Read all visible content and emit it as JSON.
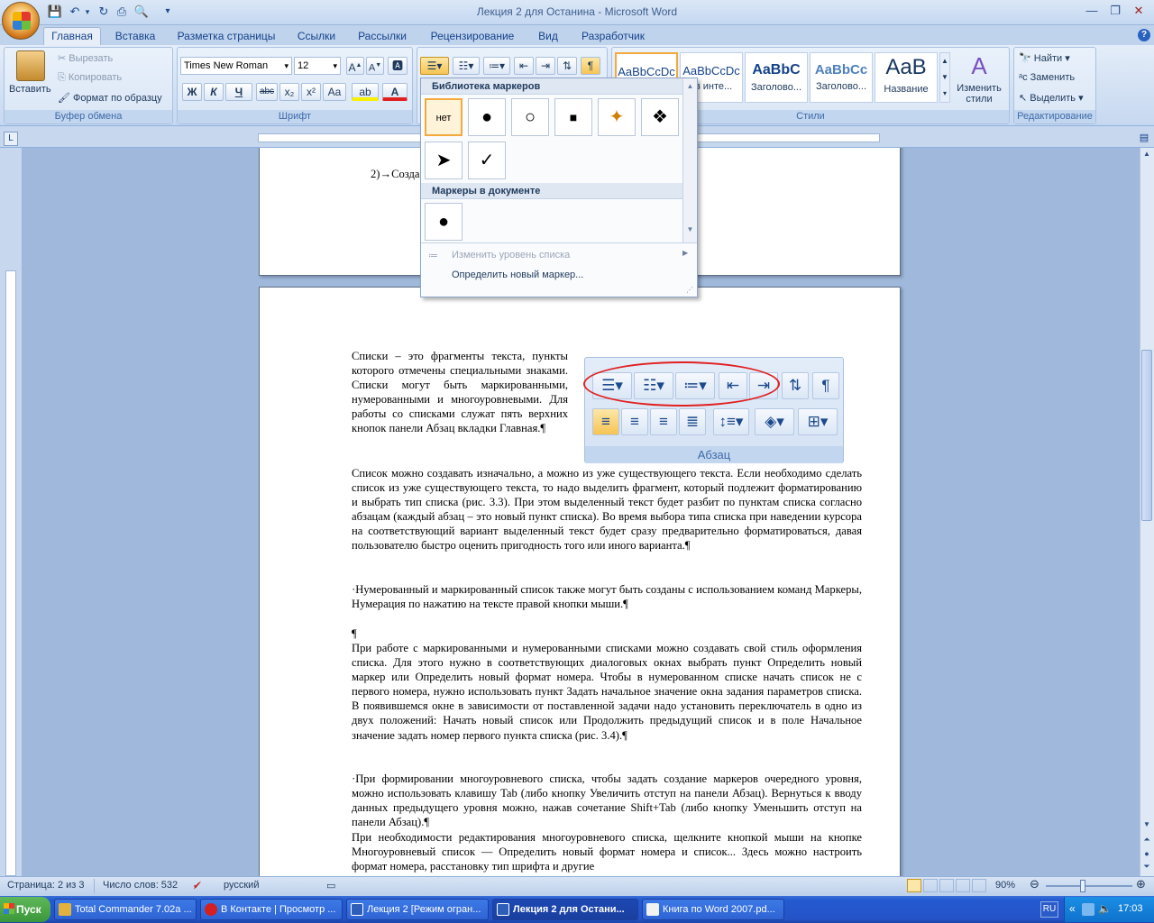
{
  "window": {
    "title": "Лекция 2 для Останина - Microsoft Word"
  },
  "tabs": [
    "Главная",
    "Вставка",
    "Разметка страницы",
    "Ссылки",
    "Рассылки",
    "Рецензирование",
    "Вид",
    "Разработчик"
  ],
  "clipboard": {
    "paste": "Вставить",
    "cut": "Вырезать",
    "copy": "Копировать",
    "format_painter": "Формат по образцу",
    "label": "Буфер обмена"
  },
  "font": {
    "name": "Times New Roman",
    "size": "12",
    "label": "Шрифт",
    "bold": "Ж",
    "italic": "К",
    "underline": "Ч",
    "strike": "abc",
    "sub": "x₂",
    "sup": "x²",
    "case": "Aa"
  },
  "styles": {
    "label": "Стили",
    "items": [
      {
        "sample": "AaBbCcDc",
        "name": ""
      },
      {
        "sample": "AaBbCcDc",
        "name": "ез инте..."
      },
      {
        "sample": "AaBbC",
        "name": "Заголово..."
      },
      {
        "sample": "AaBbCc",
        "name": "Заголово..."
      },
      {
        "sample": "AaB",
        "name": "Название"
      }
    ],
    "change": "Изменить стили"
  },
  "editing": {
    "label": "Редактирование",
    "find": "Найти",
    "replace": "Заменить",
    "select": "Выделить"
  },
  "bullet_menu": {
    "library_title": "Библиотека маркеров",
    "library": [
      "нет",
      "●",
      "○",
      "■",
      "✦",
      "❖",
      "➤",
      "✓"
    ],
    "doc_title": "Маркеры в документе",
    "doc": [
      "●"
    ],
    "change_level": "Изменить уровень списка",
    "define_new": "Определить новый маркер..."
  },
  "document": {
    "page1_line": "2)→Созда",
    "para1": "Списки – это фрагменты текста, пункты которого отмечены специальными знаками. Списки могут быть маркированными, нумерованными и многоуровневыми. Для работы со списками служат пять верхних кнопок панели Абзац вкладки Главная.¶",
    "para2": "Список можно создавать изначально, а можно из уже существующего текста. Если необходимо сделать список из уже существующего текста, то надо выделить фрагмент, который подлежит форматированию и выбрать тип списка (рис. 3.3). При этом выделенный текст будет разбит по пунктам списка согласно абзацам (каждый абзац – это новый пункт списка). Во время выбора типа списка при наведении курсора на соответствующий вариант выделенный текст будет сразу предварительно форматироваться, давая пользователю быстро оценить пригодность того или иного варианта.¶",
    "para3": "·Нумерованный и маркированный список также могут быть созданы с использованием команд Маркеры, Нумерация по нажатию на тексте правой кнопки мыши.¶",
    "para4": "¶",
    "para5": "При работе с маркированными и нумерованными списками можно создавать свой стиль оформления списка. Для этого нужно в соответствующих диалоговых окнах выбрать пункт Определить новый маркер или Определить новый формат номера. Чтобы в нумерованном списке начать список не с первого номера, нужно использовать пункт Задать начальное значение окна задания параметров списка. В появившемся окне в зависимости от поставленной задачи надо установить переключатель в одно из двух положений: Начать новый список или Продолжить предыдущий список и в поле Начальное значение задать номер первого пункта списка (рис. 3.4).¶",
    "para6": "·При формировании многоуровневого списка, чтобы задать создание маркеров очередного уровня, можно использовать клавишу Tab (либо кнопку Увеличить отступ на панели Абзац). Вернуться к вводу данных предыдущего уровня можно, нажав сочетание Shift+Tab (либо кнопку Уменьшить отступ на панели Абзац).¶",
    "para7": "При необходимости редактирования многоуровневого списка, щелкните кнопкой мыши на кнопке Многоуровневый список — Определить новый формат номера и список... Здесь можно настроить формат номера, расстановку тип шрифта и другие",
    "figure_label": "Абзац"
  },
  "status": {
    "page": "Страница: 2 из 3",
    "words": "Число слов: 532",
    "lang": "русский",
    "zoom": "90%"
  },
  "taskbar": {
    "start": "Пуск",
    "tasks": [
      "Total Commander 7.02a ...",
      "В Контакте | Просмотр ...",
      "Лекция 2 [Режим огран...",
      "Лекция 2 для Остани...",
      "Книга по Word 2007.pd..."
    ],
    "lang": "RU",
    "time": "17:03"
  },
  "colors": {
    "accent": "#15428b",
    "highlight": "#f3a93b",
    "annotation_circle": "#e02020"
  }
}
